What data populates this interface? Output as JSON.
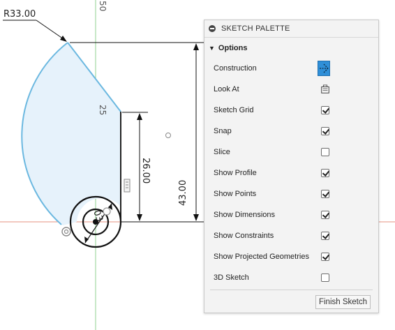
{
  "canvas": {
    "radius_label": "R33.00",
    "axis_label_top": "50",
    "axis_label_mid": "25",
    "dim_vertical_short": "26.00",
    "dim_vertical_long": "43.00",
    "dim_small_arc": "03"
  },
  "palette": {
    "title": "SKETCH PALETTE",
    "section_title": "Options",
    "rows": [
      {
        "label": "Construction",
        "control": "button",
        "icon": "construction-line-icon",
        "active": true
      },
      {
        "label": "Look At",
        "control": "button",
        "icon": "look-at-icon",
        "active": false
      },
      {
        "label": "Sketch Grid",
        "control": "checkbox",
        "checked": true
      },
      {
        "label": "Snap",
        "control": "checkbox",
        "checked": true
      },
      {
        "label": "Slice",
        "control": "checkbox",
        "checked": false
      },
      {
        "label": "Show Profile",
        "control": "checkbox",
        "checked": true
      },
      {
        "label": "Show Points",
        "control": "checkbox",
        "checked": true
      },
      {
        "label": "Show Dimensions",
        "control": "checkbox",
        "checked": true
      },
      {
        "label": "Show Constraints",
        "control": "checkbox",
        "checked": true
      },
      {
        "label": "Show Projected Geometries",
        "control": "checkbox",
        "checked": true
      },
      {
        "label": "3D Sketch",
        "control": "checkbox",
        "checked": false
      }
    ],
    "finish_label": "Finish Sketch"
  },
  "colors": {
    "accent": "#2f8fd8",
    "profile_fill": "#e6f2fb",
    "sketch_line": "#6bb8e0",
    "axis_green": "#7fc97f",
    "axis_red": "#e07a6a"
  }
}
